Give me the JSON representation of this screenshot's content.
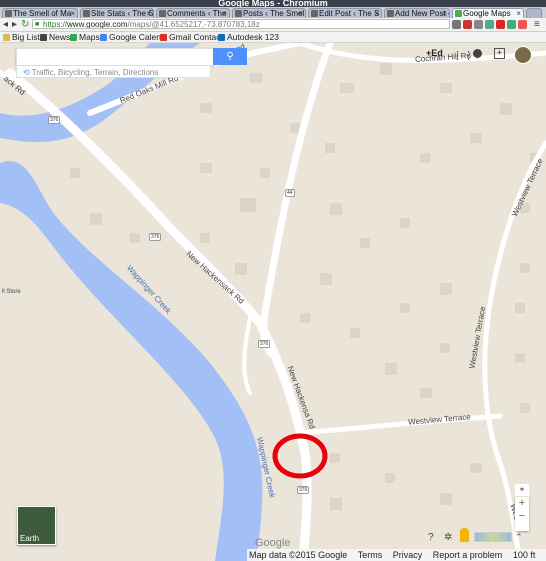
{
  "window": {
    "title": "Google Maps - Chromium"
  },
  "tabs": [
    {
      "label": "The Smell of Ma"
    },
    {
      "label": "Site Stats ‹ The S"
    },
    {
      "label": "Comments ‹ The"
    },
    {
      "label": "Posts ‹ The Smel"
    },
    {
      "label": "Edit Post ‹ The S"
    },
    {
      "label": "Add New Post ‹"
    },
    {
      "label": "Google Maps"
    }
  ],
  "address_bar": {
    "scheme": "https://",
    "host": "www.google.com",
    "path": "/maps/@41.6525217,-73.870783,18z"
  },
  "bookmarks": [
    {
      "label": "Big List",
      "icon": "folder-icon",
      "color": "#e0b84a"
    },
    {
      "label": "News",
      "icon": "news-icon",
      "color": "#444444"
    },
    {
      "label": "Maps",
      "icon": "maps-icon",
      "color": "#34a853"
    },
    {
      "label": "Google Calend",
      "icon": "calendar-icon",
      "color": "#4285f4"
    },
    {
      "label": "Gmail Contact",
      "icon": "gmail-icon",
      "color": "#d93025"
    },
    {
      "label": "Autodesk 123",
      "icon": "autodesk-icon",
      "color": "#0a6ebd"
    }
  ],
  "search": {
    "placeholder": "",
    "hint": "Traffic, Bicycling, Terrain, Directions"
  },
  "account": {
    "name": "+Ed"
  },
  "roads": {
    "oaks_top": "Oaks Mill Road",
    "red_oaks_mill": "Red Oaks Mill Rd",
    "cochran": "Cochran Hill Rd",
    "hackensack_left": "ack Rd",
    "new_hackensack": "New Hackensack Rd",
    "new_hackensack_vert": "New Hackensa Rd",
    "westview_terrace": "Westview Terrace",
    "westview_terrace_vert": "Westview Terrace",
    "westview_terrace_right": "Westview Terrace",
    "westview_bottom": "Westvi",
    "wappinger_upper": "Wappinger Creek",
    "wappinger_lower": "Wappinger Creek",
    "store": "ll Store"
  },
  "shields": {
    "s1": "376",
    "s2": "376",
    "s3": "376",
    "s4": "376",
    "s5": "44"
  },
  "earth": {
    "label": "Earth"
  },
  "branding": {
    "logo": "Google"
  },
  "footer": {
    "map_data": "Map data ©2015 Google",
    "terms": "Terms",
    "privacy": "Privacy",
    "report": "Report a problem",
    "scale": "100 ft"
  },
  "colors": {
    "water": "#a2c0f5",
    "land": "#ebe4d8",
    "road": "#ffffff",
    "highlight": "#e8000b",
    "accent": "#4d90fe"
  }
}
